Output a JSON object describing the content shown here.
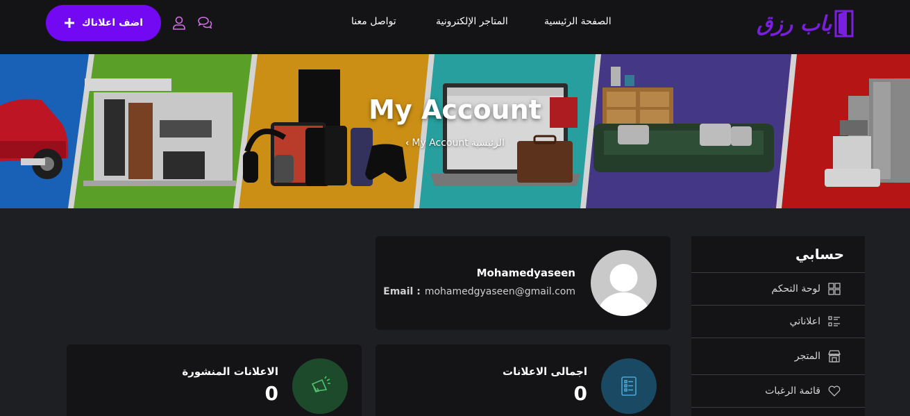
{
  "header": {
    "logo_text": "باب رزق",
    "nav": {
      "home": "الصفحة الرئيسية",
      "stores": "المتاجر الإلكترونية",
      "contact": "تواصل معنا"
    },
    "add_ad_label": "اضف اعلاناك",
    "brand_color": "#7209f2"
  },
  "banner": {
    "title": "My Account",
    "breadcrumb": {
      "home": "الرئيسية",
      "current": "My Account"
    }
  },
  "sidebar": {
    "title": "حسابي",
    "items": [
      {
        "label": "لوحة التحكم",
        "icon": "dashboard-icon"
      },
      {
        "label": "اعلاناتي",
        "icon": "list-icon"
      },
      {
        "label": "المتجر",
        "icon": "store-icon"
      },
      {
        "label": "قائمة الرغبات",
        "icon": "heart-icon"
      }
    ]
  },
  "profile": {
    "username": "Mohamedyaseen",
    "email_label": "Email :",
    "email": "mohamedgyaseen@gmail.com"
  },
  "stats": {
    "total": {
      "label": "اجمالى الاعلانات",
      "value": "0",
      "icon": "document-list-icon",
      "color": "#1a4a63"
    },
    "published": {
      "label": "الاعلانات المنشورة",
      "value": "0",
      "icon": "megaphone-icon",
      "color": "#1e4a2c"
    }
  }
}
